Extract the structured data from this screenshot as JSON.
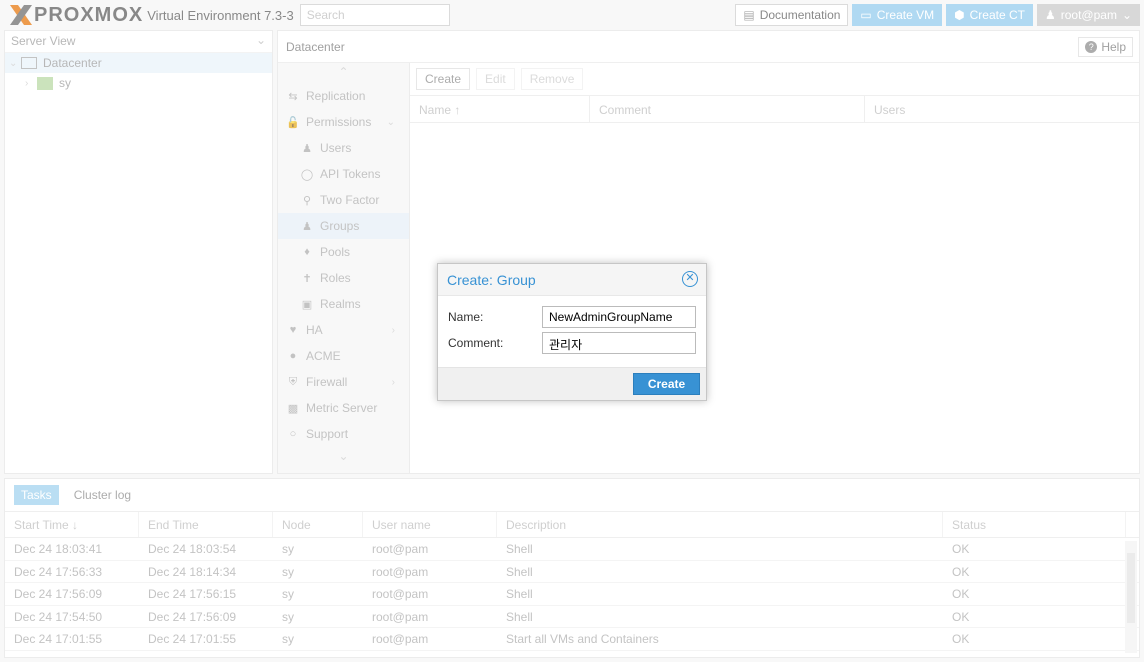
{
  "header": {
    "logo_text": "PROXMOX",
    "version": "Virtual Environment 7.3-3",
    "search_placeholder": "Search",
    "documentation": "Documentation",
    "create_vm": "Create VM",
    "create_ct": "Create CT",
    "user": "root@pam"
  },
  "tree": {
    "view": "Server View",
    "nodes": [
      {
        "label": "Datacenter"
      },
      {
        "label": "sy"
      }
    ]
  },
  "content": {
    "title": "Datacenter",
    "help": "Help"
  },
  "subnav": {
    "items": [
      {
        "label": "Replication",
        "icon": "replication-icon"
      },
      {
        "label": "Permissions",
        "icon": "unlock-icon"
      },
      {
        "label": "Users",
        "icon": "user-icon"
      },
      {
        "label": "API Tokens",
        "icon": "token-icon"
      },
      {
        "label": "Two Factor",
        "icon": "key-icon"
      },
      {
        "label": "Groups",
        "icon": "users-icon"
      },
      {
        "label": "Pools",
        "icon": "tags-icon"
      },
      {
        "label": "Roles",
        "icon": "male-icon"
      },
      {
        "label": "Realms",
        "icon": "realm-icon"
      },
      {
        "label": "HA",
        "icon": "heartbeat-icon"
      },
      {
        "label": "ACME",
        "icon": "certificate-icon"
      },
      {
        "label": "Firewall",
        "icon": "shield-icon"
      },
      {
        "label": "Metric Server",
        "icon": "bar-chart-icon"
      },
      {
        "label": "Support",
        "icon": "comments-icon"
      }
    ]
  },
  "toolbar": {
    "create": "Create",
    "edit": "Edit",
    "remove": "Remove"
  },
  "grid": {
    "columns": [
      "Name ↑",
      "Comment",
      "Users"
    ]
  },
  "dialog": {
    "title": "Create: Group",
    "name_label": "Name:",
    "name_value": "NewAdminGroupName",
    "comment_label": "Comment:",
    "comment_value": "관리자",
    "create_button": "Create"
  },
  "log": {
    "tabs": [
      "Tasks",
      "Cluster log"
    ],
    "columns": [
      "Start Time ↓",
      "End Time",
      "Node",
      "User name",
      "Description",
      "Status"
    ],
    "rows": [
      [
        "Dec 24 18:03:41",
        "Dec 24 18:03:54",
        "sy",
        "root@pam",
        "Shell",
        "OK"
      ],
      [
        "Dec 24 17:56:33",
        "Dec 24 18:14:34",
        "sy",
        "root@pam",
        "Shell",
        "OK"
      ],
      [
        "Dec 24 17:56:09",
        "Dec 24 17:56:15",
        "sy",
        "root@pam",
        "Shell",
        "OK"
      ],
      [
        "Dec 24 17:54:50",
        "Dec 24 17:56:09",
        "sy",
        "root@pam",
        "Shell",
        "OK"
      ],
      [
        "Dec 24 17:01:55",
        "Dec 24 17:01:55",
        "sy",
        "root@pam",
        "Start all VMs and Containers",
        "OK"
      ]
    ]
  }
}
